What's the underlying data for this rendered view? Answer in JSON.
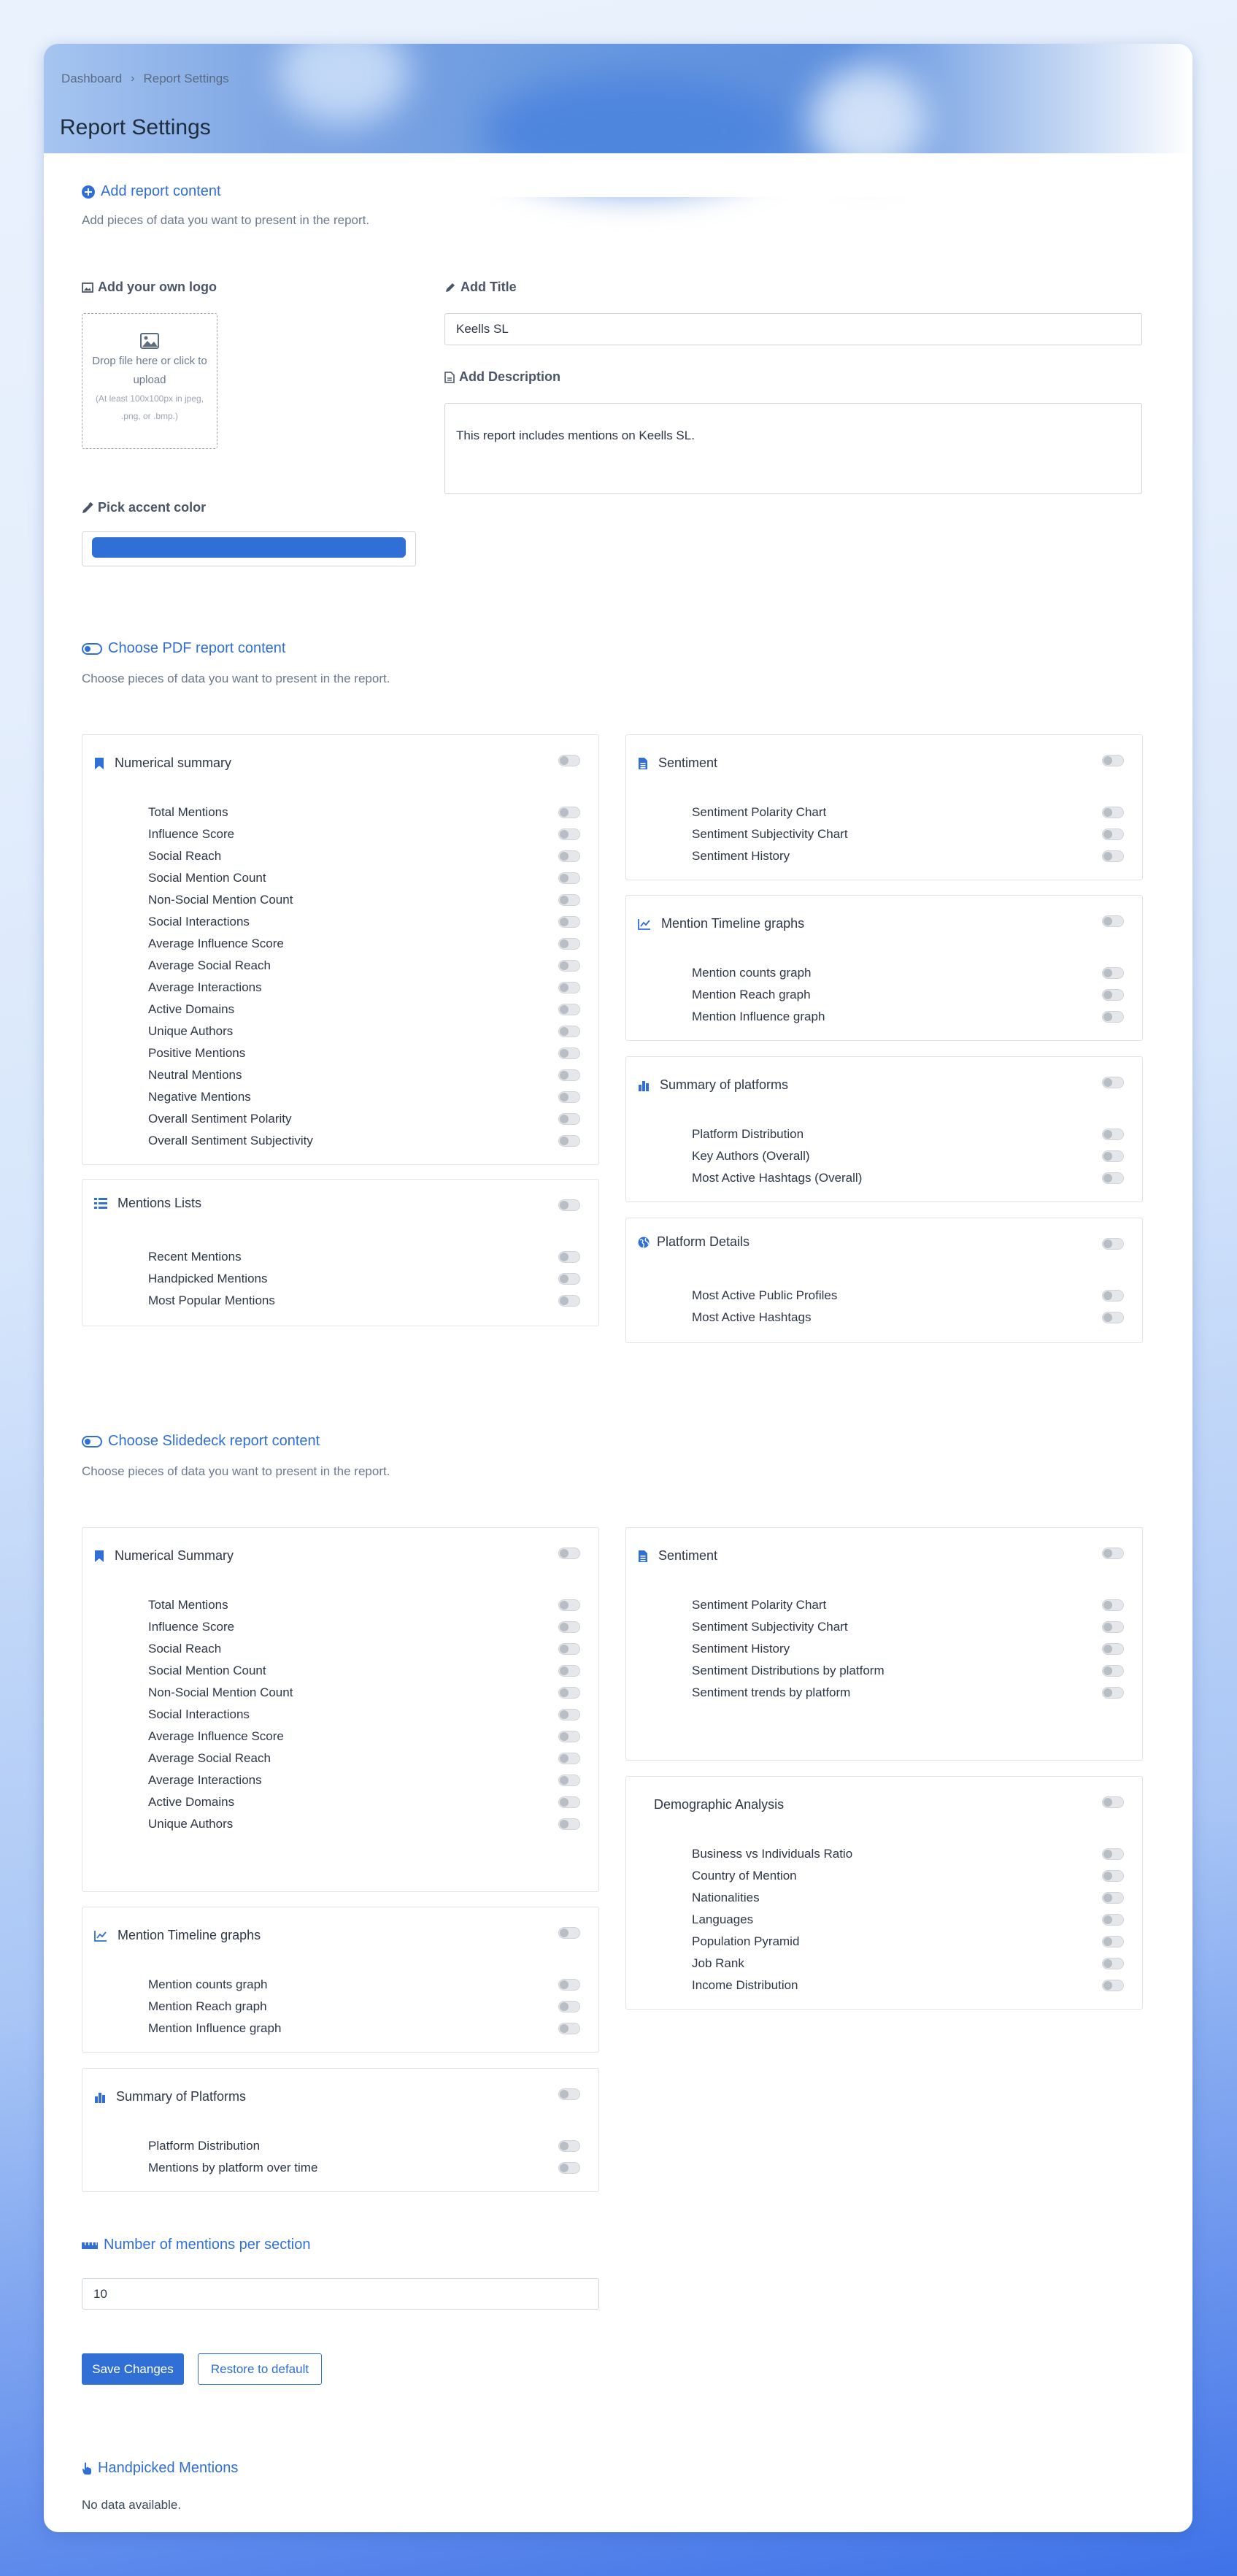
{
  "breadcrumb": {
    "home": "Dashboard",
    "current": "Report Settings"
  },
  "page_title": "Report Settings",
  "add_content": {
    "heading": "Add report content",
    "desc": "Add pieces of data you want to present in the report.",
    "logo_label": "Add your own logo",
    "drop_text_1": "Drop file here or click to",
    "drop_text_2": "upload",
    "drop_hint_1": "(At least 100x100px in jpeg,",
    "drop_hint_2": ".png, or .bmp.)",
    "title_label": "Add Title",
    "title_value": "Keells SL",
    "desc_label": "Add Description",
    "desc_value": "This report includes mentions on Keells SL.",
    "accent_label": "Pick accent color",
    "accent_color": "#2f6fd6"
  },
  "pdf": {
    "heading": "Choose PDF report content",
    "desc": "Choose pieces of data you want to present in the report.",
    "numerical": {
      "title": "Numerical summary",
      "items": [
        "Total Mentions",
        "Influence Score",
        "Social Reach",
        "Social Mention Count",
        "Non-Social Mention Count",
        "Social Interactions",
        "Average Influence Score",
        "Average Social Reach",
        "Average Interactions",
        "Active Domains",
        "Unique Authors",
        "Positive Mentions",
        "Neutral Mentions",
        "Negative Mentions",
        "Overall Sentiment Polarity",
        "Overall Sentiment Subjectivity"
      ]
    },
    "mentions_lists": {
      "title": "Mentions Lists",
      "items": [
        "Recent Mentions",
        "Handpicked Mentions",
        "Most Popular Mentions"
      ]
    },
    "sentiment": {
      "title": "Sentiment",
      "items": [
        "Sentiment Polarity Chart",
        "Sentiment Subjectivity Chart",
        "Sentiment History"
      ]
    },
    "timeline": {
      "title": "Mention Timeline graphs",
      "items": [
        "Mention counts graph",
        "Mention Reach graph",
        "Mention Influence graph"
      ]
    },
    "platforms": {
      "title": "Summary of platforms",
      "items": [
        "Platform Distribution",
        "Key Authors (Overall)",
        "Most Active Hashtags (Overall)"
      ]
    },
    "platform_details": {
      "title": "Platform Details",
      "items": [
        "Most Active Public Profiles",
        "Most Active Hashtags"
      ]
    }
  },
  "slides": {
    "heading": "Choose Slidedeck report content",
    "desc": "Choose pieces of data you want to present in the report.",
    "numerical": {
      "title": "Numerical Summary",
      "items": [
        "Total Mentions",
        "Influence Score",
        "Social Reach",
        "Social Mention Count",
        "Non-Social Mention Count",
        "Social Interactions",
        "Average Influence Score",
        "Average Social Reach",
        "Average Interactions",
        "Active Domains",
        "Unique Authors"
      ]
    },
    "timeline": {
      "title": "Mention Timeline graphs",
      "items": [
        "Mention counts graph",
        "Mention Reach graph",
        "Mention Influence graph"
      ]
    },
    "platforms": {
      "title": "Summary of Platforms",
      "items": [
        "Platform Distribution",
        "Mentions by platform over time"
      ]
    },
    "sentiment": {
      "title": "Sentiment",
      "items": [
        "Sentiment Polarity Chart",
        "Sentiment Subjectivity Chart",
        "Sentiment History",
        "Sentiment Distributions by platform",
        "Sentiment trends by platform"
      ]
    },
    "demographic": {
      "title": "Demographic Analysis",
      "items": [
        "Business vs Individuals Ratio",
        "Country of Mention",
        "Nationalities",
        "Languages",
        "Population Pyramid",
        "Job Rank",
        "Income Distribution"
      ]
    }
  },
  "mentions_per_section": {
    "heading": "Number of mentions per section",
    "value": "10"
  },
  "actions": {
    "save": "Save Changes",
    "restore": "Restore to default"
  },
  "handpicked": {
    "heading": "Handpicked Mentions",
    "empty": "No data available."
  }
}
